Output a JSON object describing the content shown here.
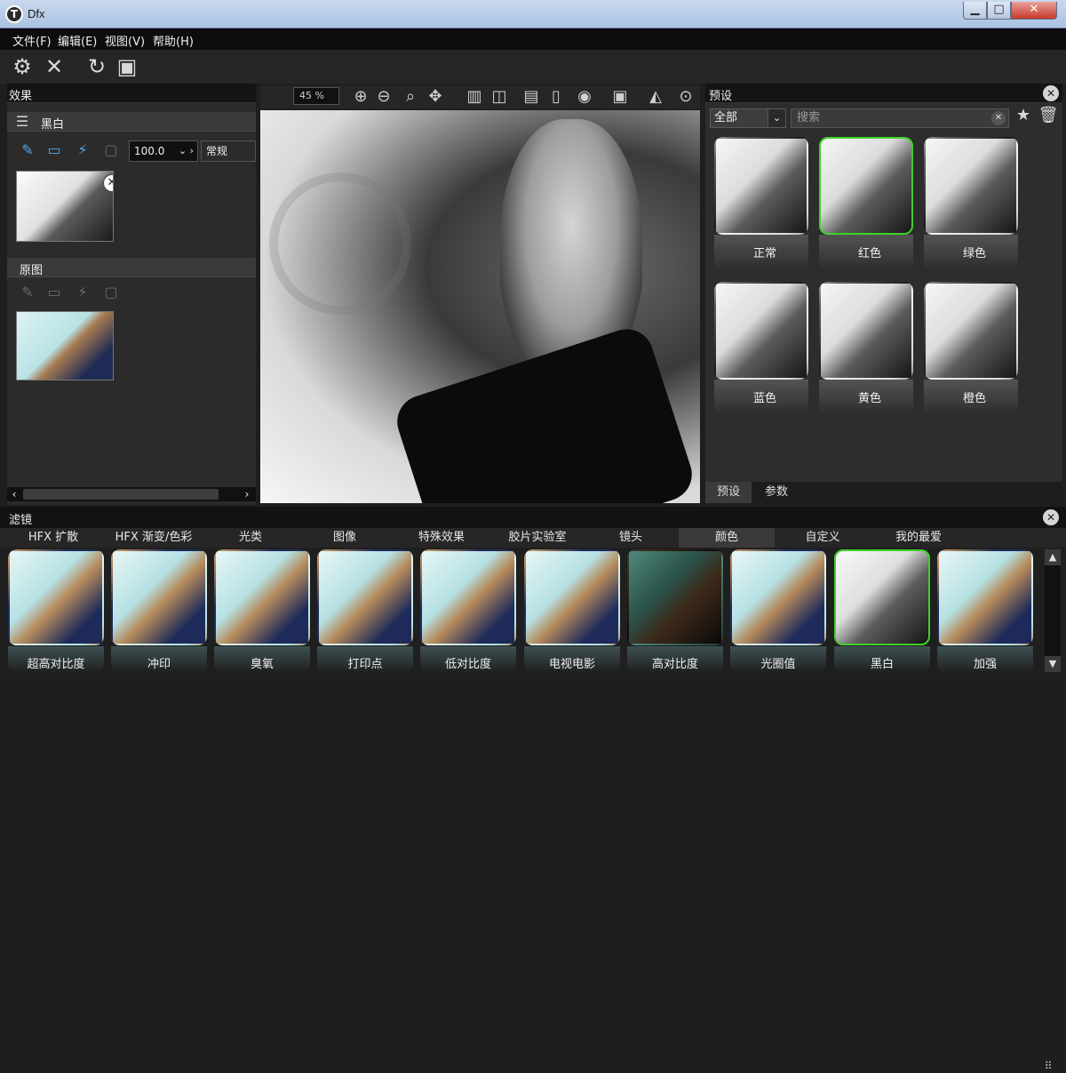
{
  "window": {
    "title": "Dfx",
    "logo_letter": "T",
    "min": "▁",
    "max": "□",
    "close": "✕"
  },
  "menu": [
    {
      "label": "文件(F)"
    },
    {
      "label": "编辑(E)"
    },
    {
      "label": "视图(V)"
    },
    {
      "label": "帮助(H)"
    }
  ],
  "toolbar": {
    "settings_icon": "⚙",
    "close_icon": "✕",
    "redo_icon": "↻",
    "image_icon": "▣"
  },
  "effects_panel": {
    "title": "效果",
    "effect_layer": {
      "name": "黑白",
      "opacity": "100.0",
      "opacity_arrows": "⌄ ›",
      "blend_mode": "常规"
    },
    "original_layer": {
      "name": "原图"
    },
    "remove_icon": "✕",
    "scroll_left": "‹",
    "scroll_right": "›"
  },
  "canvas": {
    "zoom": "45 %"
  },
  "presets_panel": {
    "title": "预设",
    "category": "全部",
    "search_placeholder": "搜索",
    "items": [
      {
        "label": "正常",
        "selected": false
      },
      {
        "label": "红色",
        "selected": true
      },
      {
        "label": "绿色",
        "selected": false
      },
      {
        "label": "蓝色",
        "selected": false
      },
      {
        "label": "黄色",
        "selected": false
      },
      {
        "label": "橙色",
        "selected": false
      }
    ],
    "tabs": [
      {
        "label": "预设"
      },
      {
        "label": "参数"
      }
    ]
  },
  "filters_panel": {
    "title": "滤镜",
    "categories": [
      {
        "label": "HFX 扩散"
      },
      {
        "label": "HFX 渐变/色彩"
      },
      {
        "label": "光类"
      },
      {
        "label": "图像"
      },
      {
        "label": "特殊效果"
      },
      {
        "label": "胶片实验室"
      },
      {
        "label": "镜头"
      },
      {
        "label": "颜色"
      },
      {
        "label": "自定义"
      },
      {
        "label": "我的最爱"
      }
    ],
    "active_category": "颜色",
    "items": [
      {
        "label": "超高对比度"
      },
      {
        "label": "冲印"
      },
      {
        "label": "臭氧"
      },
      {
        "label": "打印点"
      },
      {
        "label": "低对比度"
      },
      {
        "label": "电视电影"
      },
      {
        "label": "高对比度"
      },
      {
        "label": "光圈值"
      },
      {
        "label": "黑白"
      },
      {
        "label": "加强"
      }
    ],
    "selected_item": "黑白"
  },
  "colors": {
    "accent_selected": "#3fd12a",
    "icon_blue": "#58a7e8"
  }
}
